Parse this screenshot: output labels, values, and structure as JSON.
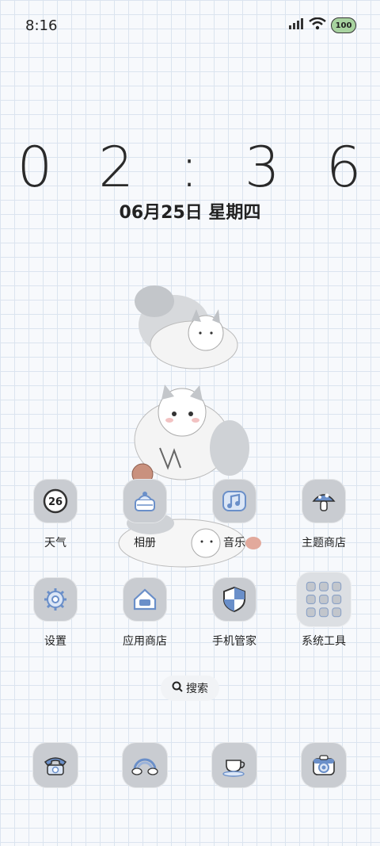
{
  "status_bar": {
    "time": "8:16",
    "battery": "100"
  },
  "clock": {
    "time": "0 2 : 3 6",
    "date": "06月25日 星期四"
  },
  "apps": [
    {
      "label": "天气",
      "icon": "weather-icon",
      "badge": "26"
    },
    {
      "label": "相册",
      "icon": "gallery-icon"
    },
    {
      "label": "音乐",
      "icon": "music-icon"
    },
    {
      "label": "主题商店",
      "icon": "theme-store-icon"
    },
    {
      "label": "设置",
      "icon": "settings-gear-icon"
    },
    {
      "label": "应用商店",
      "icon": "app-store-icon"
    },
    {
      "label": "手机管家",
      "icon": "phone-manager-shield-icon"
    },
    {
      "label": "系统工具",
      "icon": "system-tools-folder-icon"
    }
  ],
  "search": {
    "label": "搜索"
  },
  "dock": [
    {
      "icon": "phone-icon"
    },
    {
      "icon": "messages-rainbow-icon"
    },
    {
      "icon": "browser-teacup-icon"
    },
    {
      "icon": "camera-icon"
    }
  ],
  "colors": {
    "icon_bg": "#c9ccd1",
    "icon_accent": "#6a8fc9",
    "grid_line": "#dbe4ef"
  }
}
